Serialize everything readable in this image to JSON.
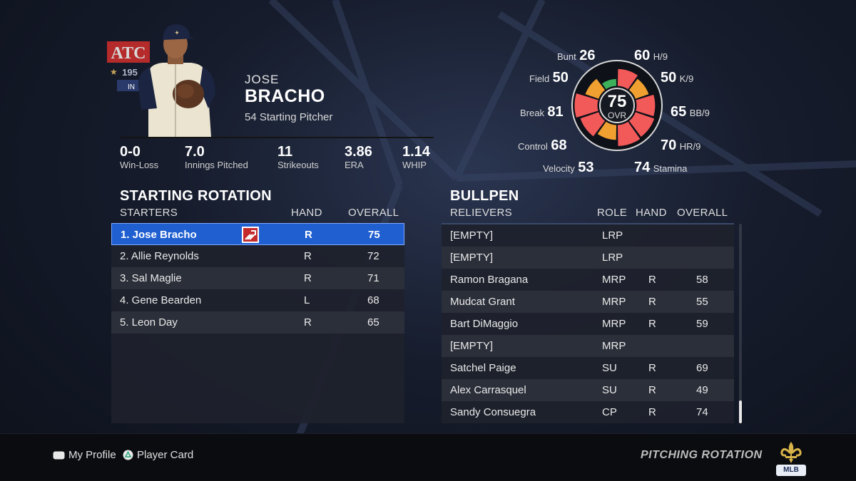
{
  "player": {
    "first_name": "JOSE",
    "last_name": "BRACHO",
    "number_position": "54  Starting Pitcher",
    "team_logo_text": "ATC",
    "team_logo_year": "195"
  },
  "season_stats": [
    {
      "value": "0-0",
      "label": "Win-Loss"
    },
    {
      "value": "7.0",
      "label": "Innings Pitched"
    },
    {
      "value": "11",
      "label": "Strikeouts"
    },
    {
      "value": "3.86",
      "label": "ERA"
    },
    {
      "value": "1.14",
      "label": "WHIP"
    }
  ],
  "ratings": {
    "overall": "75",
    "overall_label": "OVR",
    "left": [
      {
        "label": "Bunt",
        "value": "26"
      },
      {
        "label": "Field",
        "value": "50"
      },
      {
        "label": "Break",
        "value": "81"
      },
      {
        "label": "Control",
        "value": "68"
      },
      {
        "label": "Velocity",
        "value": "53"
      }
    ],
    "right": [
      {
        "label": "H/9",
        "value": "60"
      },
      {
        "label": "K/9",
        "value": "50"
      },
      {
        "label": "BB/9",
        "value": "65"
      },
      {
        "label": "HR/9",
        "value": "70"
      },
      {
        "label": "Stamina",
        "value": "74"
      }
    ],
    "colors": {
      "high": "#f25a5a",
      "mid": "#f0a030",
      "good": "#3cb05a"
    }
  },
  "rotation": {
    "title": "STARTING ROTATION",
    "columns": [
      "STARTERS",
      "HAND",
      "OVERALL"
    ],
    "rows": [
      {
        "name": "1.  Jose Bracho",
        "hand": "R",
        "overall": "75",
        "selected": true,
        "icon": "hot-streak-icon"
      },
      {
        "name": "2.  Allie Reynolds",
        "hand": "R",
        "overall": "72"
      },
      {
        "name": "3.  Sal Maglie",
        "hand": "R",
        "overall": "71"
      },
      {
        "name": "4.  Gene Bearden",
        "hand": "L",
        "overall": "68"
      },
      {
        "name": "5.  Leon Day",
        "hand": "R",
        "overall": "65"
      }
    ]
  },
  "bullpen": {
    "title": "BULLPEN",
    "columns": [
      "RELIEVERS",
      "ROLE",
      "HAND",
      "OVERALL"
    ],
    "rows": [
      {
        "name": "[EMPTY]",
        "role": "LRP",
        "hand": "",
        "overall": ""
      },
      {
        "name": "[EMPTY]",
        "role": "LRP",
        "hand": "",
        "overall": ""
      },
      {
        "name": "Ramon Bragana",
        "role": "MRP",
        "hand": "R",
        "overall": "58"
      },
      {
        "name": "Mudcat Grant",
        "role": "MRP",
        "hand": "R",
        "overall": "55"
      },
      {
        "name": "Bart DiMaggio",
        "role": "MRP",
        "hand": "R",
        "overall": "59"
      },
      {
        "name": "[EMPTY]",
        "role": "MRP",
        "hand": "",
        "overall": ""
      },
      {
        "name": "Satchel Paige",
        "role": "SU",
        "hand": "R",
        "overall": "69"
      },
      {
        "name": "Alex Carrasquel",
        "role": "SU",
        "hand": "R",
        "overall": "49"
      },
      {
        "name": "Sandy Consuegra",
        "role": "CP",
        "hand": "R",
        "overall": "74"
      }
    ]
  },
  "footer": {
    "hint_profile": "My Profile",
    "hint_card": "Player Card",
    "screen_title": "PITCHING ROTATION",
    "badge": "MLB"
  }
}
